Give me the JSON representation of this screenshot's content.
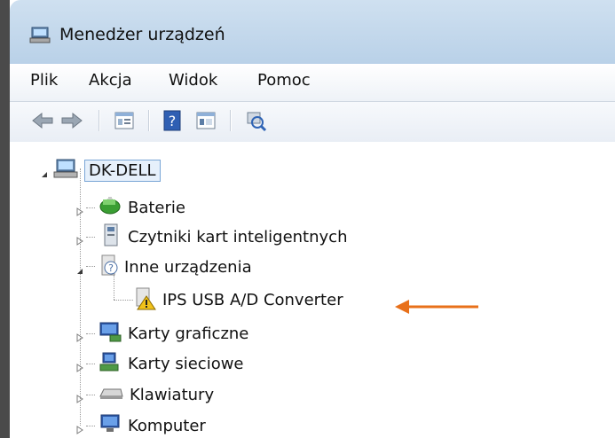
{
  "window": {
    "title": "Menedżer urządzeń"
  },
  "menu": {
    "items": [
      {
        "label": "Plik"
      },
      {
        "label": "Akcja"
      },
      {
        "label": "Widok"
      },
      {
        "label": "Pomoc"
      }
    ]
  },
  "toolbar": {
    "icons": [
      "back-arrow-icon",
      "forward-arrow-icon",
      "properties-icon",
      "help-icon",
      "view-icon",
      "scan-hardware-icon"
    ]
  },
  "tree": {
    "root": {
      "label": "DK-DELL"
    },
    "items": [
      {
        "label": "Baterie",
        "icon": "battery-icon",
        "state": "collapsed"
      },
      {
        "label": "Czytniki kart inteligentnych",
        "icon": "smartcard-reader-icon",
        "state": "collapsed"
      },
      {
        "label": "Inne urządzenia",
        "icon": "unknown-device-icon",
        "state": "expanded"
      },
      {
        "label": "IPS USB A/D Converter",
        "icon": "warning-device-icon",
        "state": "child"
      },
      {
        "label": "Karty graficzne",
        "icon": "display-adapter-icon",
        "state": "collapsed"
      },
      {
        "label": "Karty sieciowe",
        "icon": "network-adapter-icon",
        "state": "collapsed"
      },
      {
        "label": "Klawiatury",
        "icon": "keyboard-icon",
        "state": "collapsed"
      },
      {
        "label": "Komputer",
        "icon": "computer-icon",
        "state": "collapsed"
      }
    ]
  },
  "annotation": {
    "arrow_color": "#e8701a"
  },
  "colors": {
    "titlebar": "#c4d8ec",
    "selection_border": "#7aa6d6"
  }
}
